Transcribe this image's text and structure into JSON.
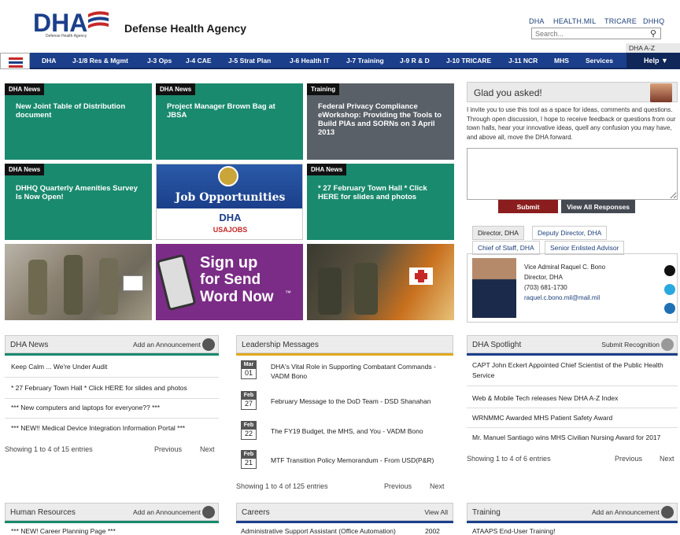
{
  "header": {
    "logo_text": "DHA",
    "logo_subtext": "Defense Health Agency",
    "title": "Defense Health Agency",
    "toplinks": [
      "DHA",
      "HEALTH.MIL",
      "TRICARE",
      "DHHQ"
    ],
    "search_placeholder": "Search...",
    "az_index": "DHA A-Z INDEX"
  },
  "nav": {
    "items": [
      "DHA",
      "J-1/8 Res & Mgmt",
      "J-3 Ops",
      "J-4 CAE",
      "J-5 Strat Plan",
      "J-6 Health IT",
      "J-7 Training",
      "J-9 R & D",
      "J-10 TRICARE",
      "J-11 NCR",
      "MHS",
      "Services"
    ],
    "help": "Help ▼"
  },
  "tiles": [
    {
      "tag": "DHA News",
      "title": "New Joint Table of Distribution document"
    },
    {
      "tag": "DHA News",
      "title": "Project Manager Brown Bag at JBSA"
    },
    {
      "tag": "Training",
      "title": "Federal Privacy Compliance eWorkshop: Providing the Tools to Build PIAs and SORNs on 3 April 2013"
    },
    {
      "tag": "DHA News",
      "title": "DHHQ Quarterly Amenities Survey Is Now Open!"
    },
    {
      "tag": "DHA News",
      "title": "* 27 February Town Hall * Click HERE for slides and photos"
    }
  ],
  "jobs": {
    "title": "Job Opportunities",
    "logo": "DHA",
    "sub": "USAJOBS"
  },
  "signup": {
    "line1": "Sign up",
    "line2": "for Send",
    "line3": "Word Now",
    "tm": "™"
  },
  "feedback": {
    "title": "Glad you asked!",
    "text": "I invite you to use this tool as a space for ideas, comments and questions. Through open discussion, I hope to receive feedback or questions from our town halls, hear your innovative ideas, quell any confusion you may have, and above all, move the DHA forward.",
    "submit": "Submit",
    "view_all": "View All Responses"
  },
  "leadership_tabs": [
    "Director, DHA",
    "Deputy Director, DHA",
    "Chief of Staff, DHA",
    "Senior Enlisted Advisor"
  ],
  "leader": {
    "name": "Vice Admiral Raquel C. Bono",
    "role": "Director, DHA",
    "phone": "(703) 681-1730",
    "email": "raquel.c.bono.mil@mail.mil"
  },
  "dha_news": {
    "title": "DHA News",
    "action": "Add an Announcement",
    "items": [
      "Keep Calm ... We're Under Audit",
      "* 27 February Town Hall * Click HERE for slides and photos",
      "*** New computers and laptops for everyone?? ***",
      "*** NEW!! Medical Device Integration Information Portal ***"
    ],
    "showing": "Showing 1 to 4 of 15 entries",
    "prev": "Previous",
    "next": "Next"
  },
  "leadership_messages": {
    "title": "Leadership Messages",
    "items": [
      {
        "month": "Mar",
        "day": "01",
        "text": "DHA's Vital Role in Supporting Combatant Commands - VADM Bono"
      },
      {
        "month": "Feb",
        "day": "27",
        "text": "February Message to the DoD Team - DSD Shanahan"
      },
      {
        "month": "Feb",
        "day": "22",
        "text": "The FY19 Budget, the MHS, and You - VADM Bono"
      },
      {
        "month": "Feb",
        "day": "21",
        "text": "MTF Transition Policy Memorandum - From USD(P&R)"
      }
    ],
    "showing": "Showing 1 to 4 of 125 entries",
    "prev": "Previous",
    "next": "Next"
  },
  "spotlight": {
    "title": "DHA Spotlight",
    "action": "Submit Recognition",
    "items": [
      "CAPT John Eckert Appointed Chief Scientist of the Public Health Service",
      "Web & Mobile Tech releases New DHA A-Z Index",
      "WRNMMC Awarded MHS Patient Safety Award",
      "Mr. Manuel Santiago wins MHS Civilian Nursing Award for 2017"
    ],
    "showing": "Showing 1 to 4 of 6 entries",
    "prev": "Previous",
    "next": "Next"
  },
  "human_resources": {
    "title": "Human Resources",
    "action": "Add an Announcement",
    "first_item": "*** NEW! Career Planning Page ***"
  },
  "careers": {
    "title": "Careers",
    "action": "View All",
    "first_item": "Administrative Support Assistant (Office Automation)",
    "first_value": "2002"
  },
  "training": {
    "title": "Training",
    "action": "Add an Announcement",
    "first_item": "ATAAPS End-User Training!"
  },
  "colors": {
    "nav": "#1b3f8a",
    "teal": "#1a8a6e",
    "gray": "#596068",
    "red": "#8a1d1d",
    "gold": "#e0a81e"
  }
}
